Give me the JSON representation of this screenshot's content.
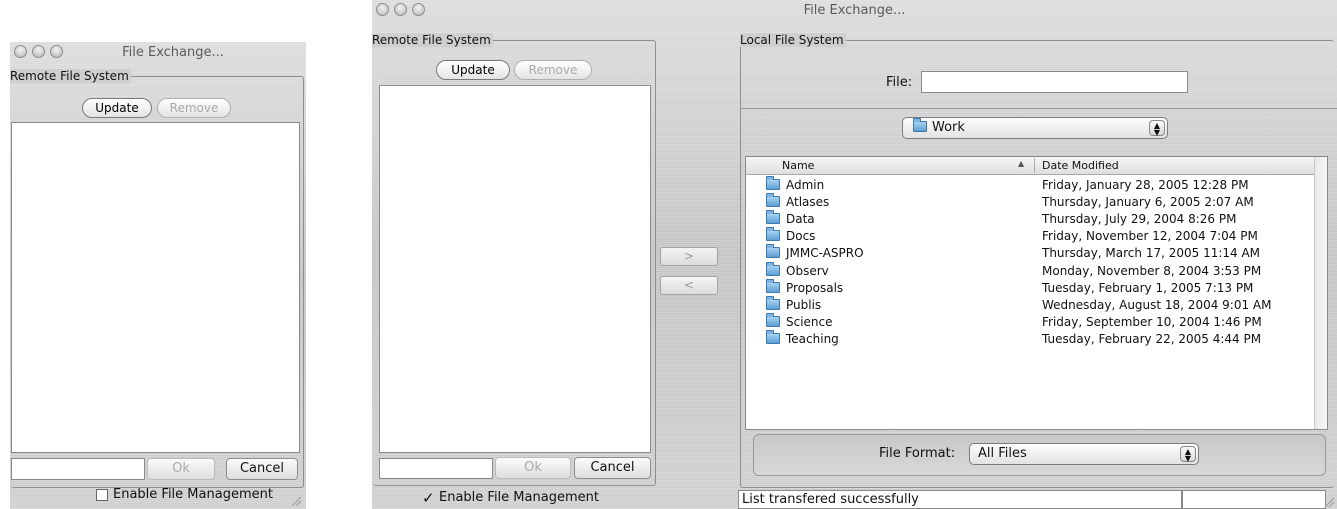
{
  "small_window": {
    "title": "File Exchange...",
    "remote_label": "Remote File System",
    "update_label": "Update",
    "remove_label": "Remove",
    "path_value": "",
    "ok_label": "Ok",
    "cancel_label": "Cancel",
    "enable_label": "Enable File Management",
    "enable_checked": false
  },
  "main_window": {
    "title": "File Exchange...",
    "remote_label": "Remote File System",
    "update_label": "Update",
    "remove_label": "Remove",
    "path_value": "",
    "ok_label": "Ok",
    "cancel_label": "Cancel",
    "enable_label": "Enable File Management",
    "enable_checked": true,
    "transfer_right_label": ">",
    "transfer_left_label": "<",
    "local_label": "Local File System",
    "file_label": "File:",
    "file_value": "",
    "folder_popup": "Work",
    "columns": {
      "name": "Name",
      "date": "Date Modified",
      "sort_indicator": "▲"
    },
    "files": [
      {
        "name": "Admin",
        "date": "Friday, January 28, 2005 12:28 PM"
      },
      {
        "name": "Atlases",
        "date": "Thursday, January 6, 2005 2:07 AM"
      },
      {
        "name": "Data",
        "date": "Thursday, July 29, 2004 8:26 PM"
      },
      {
        "name": "Docs",
        "date": "Friday, November 12, 2004 7:04 PM"
      },
      {
        "name": "JMMC-ASPRO",
        "date": "Thursday, March 17, 2005 11:14 AM"
      },
      {
        "name": "Observ",
        "date": "Monday, November 8, 2004 3:53 PM"
      },
      {
        "name": "Proposals",
        "date": "Tuesday, February 1, 2005 7:13 PM"
      },
      {
        "name": "Publis",
        "date": "Wednesday, August 18, 2004 9:01 AM"
      },
      {
        "name": "Science",
        "date": "Friday, September 10, 2004 1:46 PM"
      },
      {
        "name": "Teaching",
        "date": "Tuesday, February 22, 2005 4:44 PM"
      }
    ],
    "format_label": "File Format:",
    "format_value": "All Files",
    "status_text": "List transfered successfully"
  },
  "icons": {
    "folder": "folder-icon",
    "check": "checkmark-icon",
    "stepper": "popup-arrows-icon",
    "grip": "resize-grip-icon"
  }
}
